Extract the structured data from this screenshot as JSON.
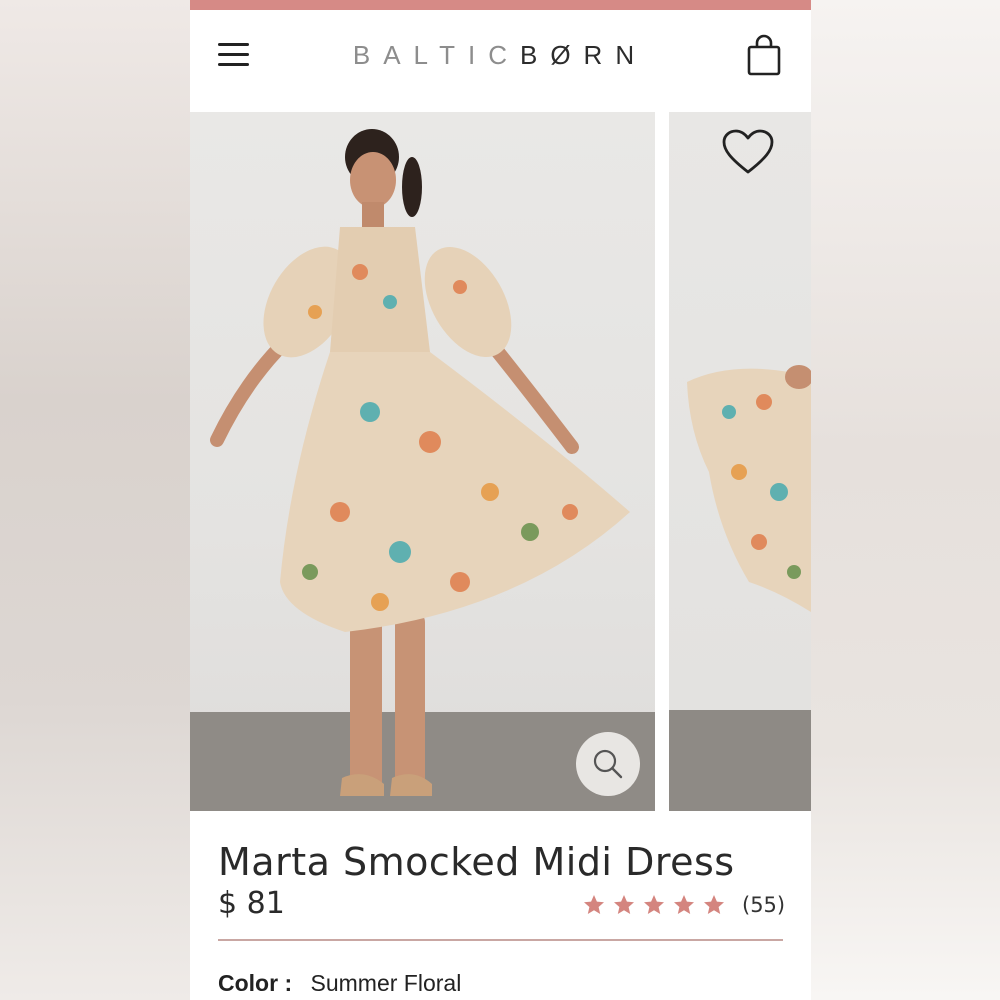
{
  "brand": {
    "part1": "BALTIC",
    "part2": "BØRN"
  },
  "header": {
    "menu_icon": "hamburger-menu-icon",
    "cart_icon": "shopping-bag-icon"
  },
  "gallery": {
    "zoom_icon": "magnifier-icon",
    "favorite_icon": "heart-icon"
  },
  "product": {
    "name": "Marta Smocked Midi Dress",
    "price": "$ 81",
    "rating": 5,
    "review_count": "(55)",
    "color_label": "Color :",
    "color_value": "Summer Floral"
  },
  "colors": {
    "accent": "#d68a86",
    "star": "#d4857f",
    "divider": "#c9a7a3"
  }
}
